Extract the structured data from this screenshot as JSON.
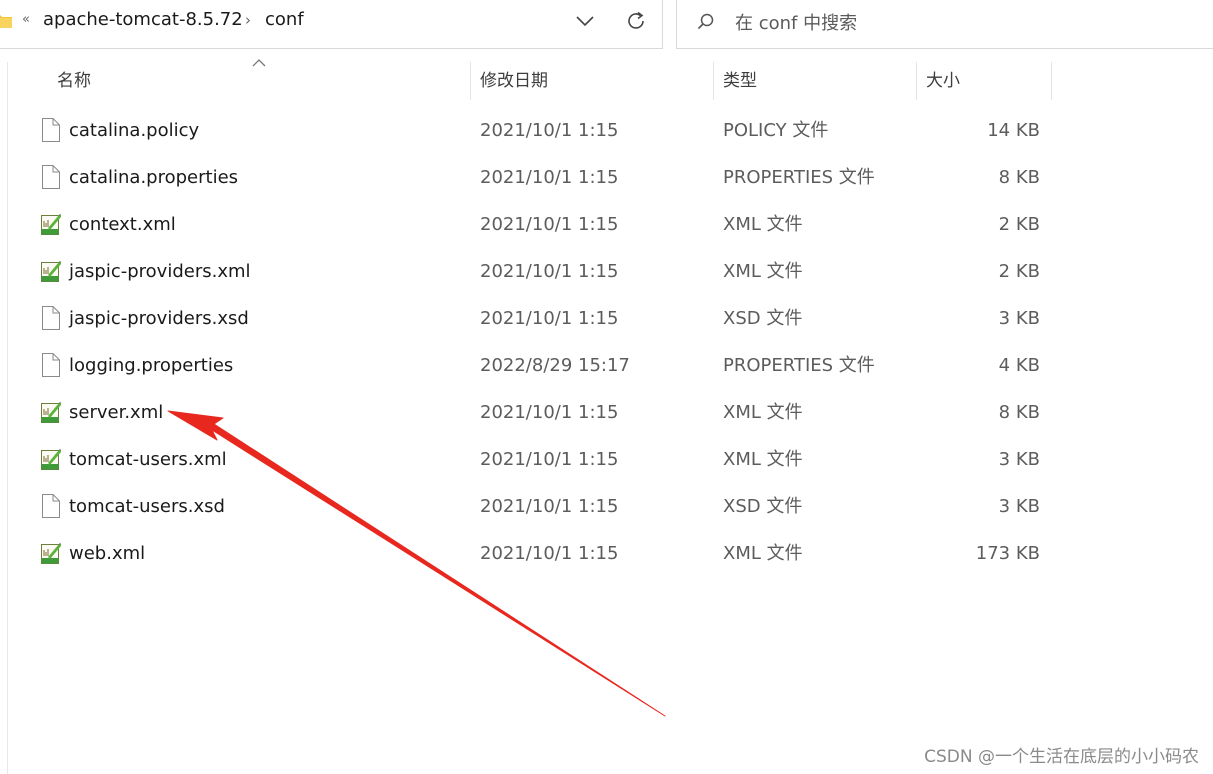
{
  "address": {
    "overflow": "«",
    "crumbs": [
      "apache-tomcat-8.5.72",
      "conf"
    ],
    "separator": "›"
  },
  "search": {
    "placeholder": "在 conf 中搜索"
  },
  "columns": {
    "name": "名称",
    "date": "修改日期",
    "type": "类型",
    "size": "大小"
  },
  "files": [
    {
      "name": "catalina.policy",
      "date": "2021/10/1 1:15",
      "type": "POLICY 文件",
      "size": "14 KB",
      "icon": "file-icon"
    },
    {
      "name": "catalina.properties",
      "date": "2021/10/1 1:15",
      "type": "PROPERTIES 文件",
      "size": "8 KB",
      "icon": "file-icon"
    },
    {
      "name": "context.xml",
      "date": "2021/10/1 1:15",
      "type": "XML 文件",
      "size": "2 KB",
      "icon": "xml-file-icon"
    },
    {
      "name": "jaspic-providers.xml",
      "date": "2021/10/1 1:15",
      "type": "XML 文件",
      "size": "2 KB",
      "icon": "xml-file-icon"
    },
    {
      "name": "jaspic-providers.xsd",
      "date": "2021/10/1 1:15",
      "type": "XSD 文件",
      "size": "3 KB",
      "icon": "file-icon"
    },
    {
      "name": "logging.properties",
      "date": "2022/8/29 15:17",
      "type": "PROPERTIES 文件",
      "size": "4 KB",
      "icon": "file-icon"
    },
    {
      "name": "server.xml",
      "date": "2021/10/1 1:15",
      "type": "XML 文件",
      "size": "8 KB",
      "icon": "xml-file-icon"
    },
    {
      "name": "tomcat-users.xml",
      "date": "2021/10/1 1:15",
      "type": "XML 文件",
      "size": "3 KB",
      "icon": "xml-file-icon"
    },
    {
      "name": "tomcat-users.xsd",
      "date": "2021/10/1 1:15",
      "type": "XSD 文件",
      "size": "3 KB",
      "icon": "file-icon"
    },
    {
      "name": "web.xml",
      "date": "2021/10/1 1:15",
      "type": "XML 文件",
      "size": "173 KB",
      "icon": "xml-file-icon"
    }
  ],
  "annotation": {
    "color": "#e8281f"
  },
  "watermark": "CSDN @一个生活在底层的小小码农"
}
